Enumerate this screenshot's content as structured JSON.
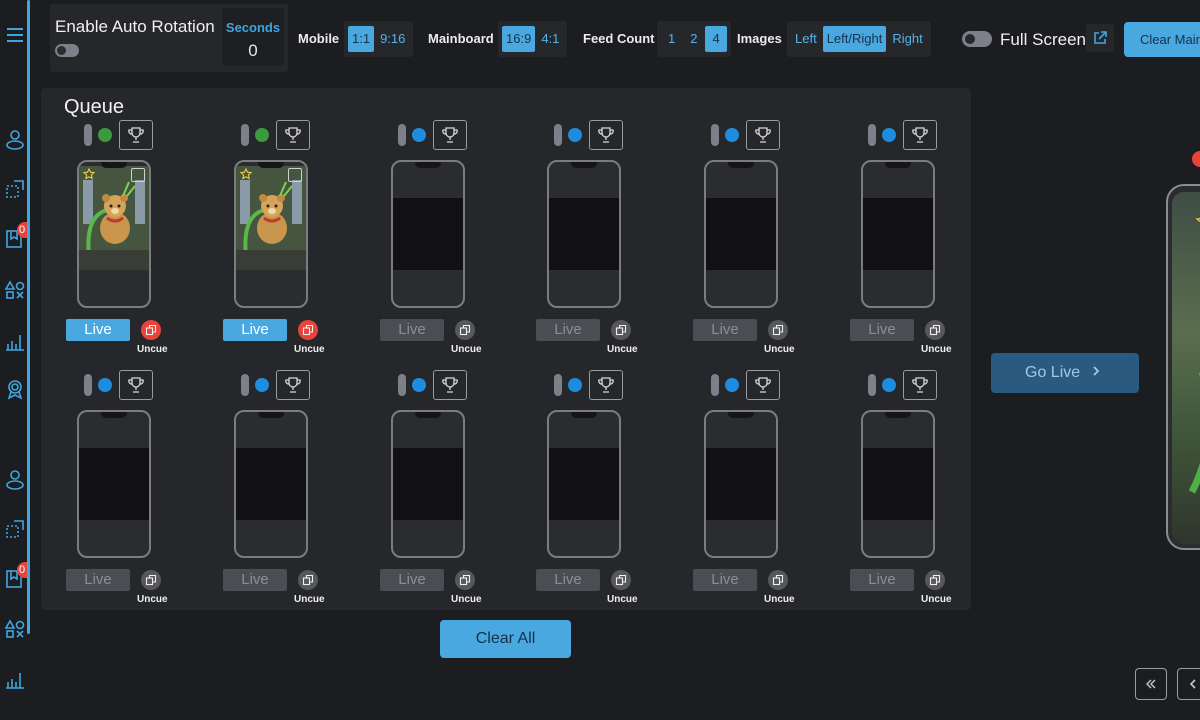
{
  "topbar": {
    "auto_rotation_label": "Enable Auto Rotation",
    "seconds_label": "Seconds",
    "seconds_value": "0",
    "mobile_label": "Mobile",
    "mobile_options": [
      "1:1",
      "9:16"
    ],
    "mobile_selected": "1:1",
    "mainboard_label": "Mainboard",
    "mainboard_options": [
      "16:9",
      "4:1"
    ],
    "mainboard_selected": "16:9",
    "feed_count_label": "Feed Count",
    "feed_count_options": [
      "1",
      "2",
      "4"
    ],
    "feed_count_selected": "4",
    "images_label": "Images",
    "images_options": [
      "Left",
      "Left/Right",
      "Right"
    ],
    "images_selected": "Left/Right",
    "full_screen_label": "Full Screen",
    "clear_main_label": "Clear Main"
  },
  "sidebar": {
    "badge_1": "0",
    "badge_2": "0"
  },
  "queue": {
    "title": "Queue",
    "live_label": "Live",
    "uncue_label": "Uncue",
    "colors": {
      "green_dot": "#3a9a3f",
      "blue_dot": "#1e8de0",
      "accent": "#4aa8e0",
      "danger": "#e8443a"
    },
    "cells": [
      {
        "status": "green",
        "has_image": true,
        "live": true
      },
      {
        "status": "green",
        "has_image": true,
        "live": true
      },
      {
        "status": "blue",
        "has_image": false,
        "live": false
      },
      {
        "status": "blue",
        "has_image": false,
        "live": false
      },
      {
        "status": "blue",
        "has_image": false,
        "live": false
      },
      {
        "status": "blue",
        "has_image": false,
        "live": false
      },
      {
        "status": "blue",
        "has_image": false,
        "live": false
      },
      {
        "status": "blue",
        "has_image": false,
        "live": false
      },
      {
        "status": "blue",
        "has_image": false,
        "live": false
      },
      {
        "status": "blue",
        "has_image": false,
        "live": false
      },
      {
        "status": "blue",
        "has_image": false,
        "live": false
      },
      {
        "status": "blue",
        "has_image": false,
        "live": false
      }
    ]
  },
  "clear_all_label": "Clear All",
  "go_live_label": "Go Live"
}
